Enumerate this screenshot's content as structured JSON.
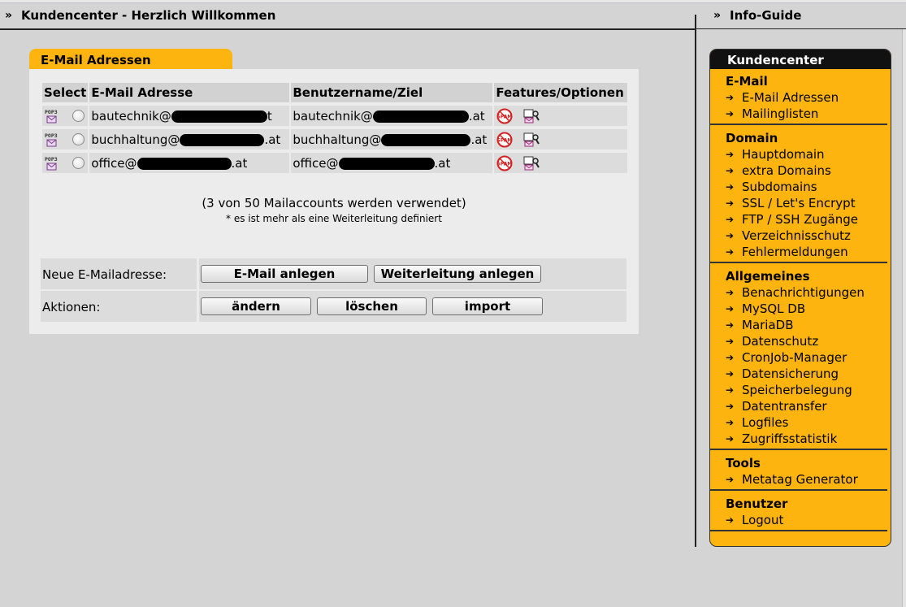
{
  "header": {
    "left_chevron": "»",
    "left_title": "Kundencenter - Herzlich Willkommen",
    "right_chevron": "»",
    "right_title": "Info-Guide"
  },
  "panel": {
    "tab_label": "E-Mail Adressen",
    "columns": [
      "Select",
      "E-Mail Adresse",
      "Benutzername/Ziel",
      "Features/Optionen"
    ],
    "rows": [
      {
        "email_prefix": "bautechnik@",
        "email_suffix": "t",
        "user_prefix": "bautechnik@",
        "user_suffix": ".at",
        "pop3_label": "POP3"
      },
      {
        "email_prefix": "buchhaltung@",
        "email_suffix": ".at",
        "user_prefix": "buchhaltung@",
        "user_suffix": ".at",
        "pop3_label": "POP3"
      },
      {
        "email_prefix": "office@",
        "email_suffix": ".at",
        "user_prefix": "office@",
        "user_suffix": ".at",
        "pop3_label": "POP3"
      }
    ],
    "summary": "(3 von 50 Mailaccounts werden verwendet)",
    "note": "* es ist mehr als eine Weiterleitung definiert",
    "new_label": "Neue E-Mailadresse:",
    "new_buttons": [
      "E-Mail anlegen",
      "Weiterleitung anlegen"
    ],
    "actions_label": "Aktionen:",
    "action_buttons": [
      "ändern",
      "löschen",
      "import"
    ],
    "spam_icon_text": "SPAM"
  },
  "sidebar": {
    "title": "Kundencenter",
    "sections": [
      {
        "heading": "E-Mail",
        "items": [
          "E-Mail Adressen",
          "Mailinglisten"
        ]
      },
      {
        "heading": "Domain",
        "items": [
          "Hauptdomain",
          "extra Domains",
          "Subdomains",
          "SSL / Let's Encrypt",
          "FTP / SSH Zugänge",
          "Verzeichnisschutz",
          "Fehlermeldungen"
        ]
      },
      {
        "heading": "Allgemeines",
        "items": [
          "Benachrichtigungen",
          "MySQL DB",
          "MariaDB",
          "Datenschutz",
          "CronJob-Manager",
          "Datensicherung",
          "Speicherbelegung",
          "Datentransfer",
          "Logfiles",
          "Zugriffsstatistik"
        ]
      },
      {
        "heading": "Tools",
        "items": [
          "Metatag Generator"
        ]
      },
      {
        "heading": "Benutzer",
        "items": [
          "Logout"
        ]
      }
    ],
    "arrow": "➔"
  },
  "colors": {
    "accent": "#fdb40f",
    "background": "#d4d4d4",
    "panel": "#ececec"
  }
}
